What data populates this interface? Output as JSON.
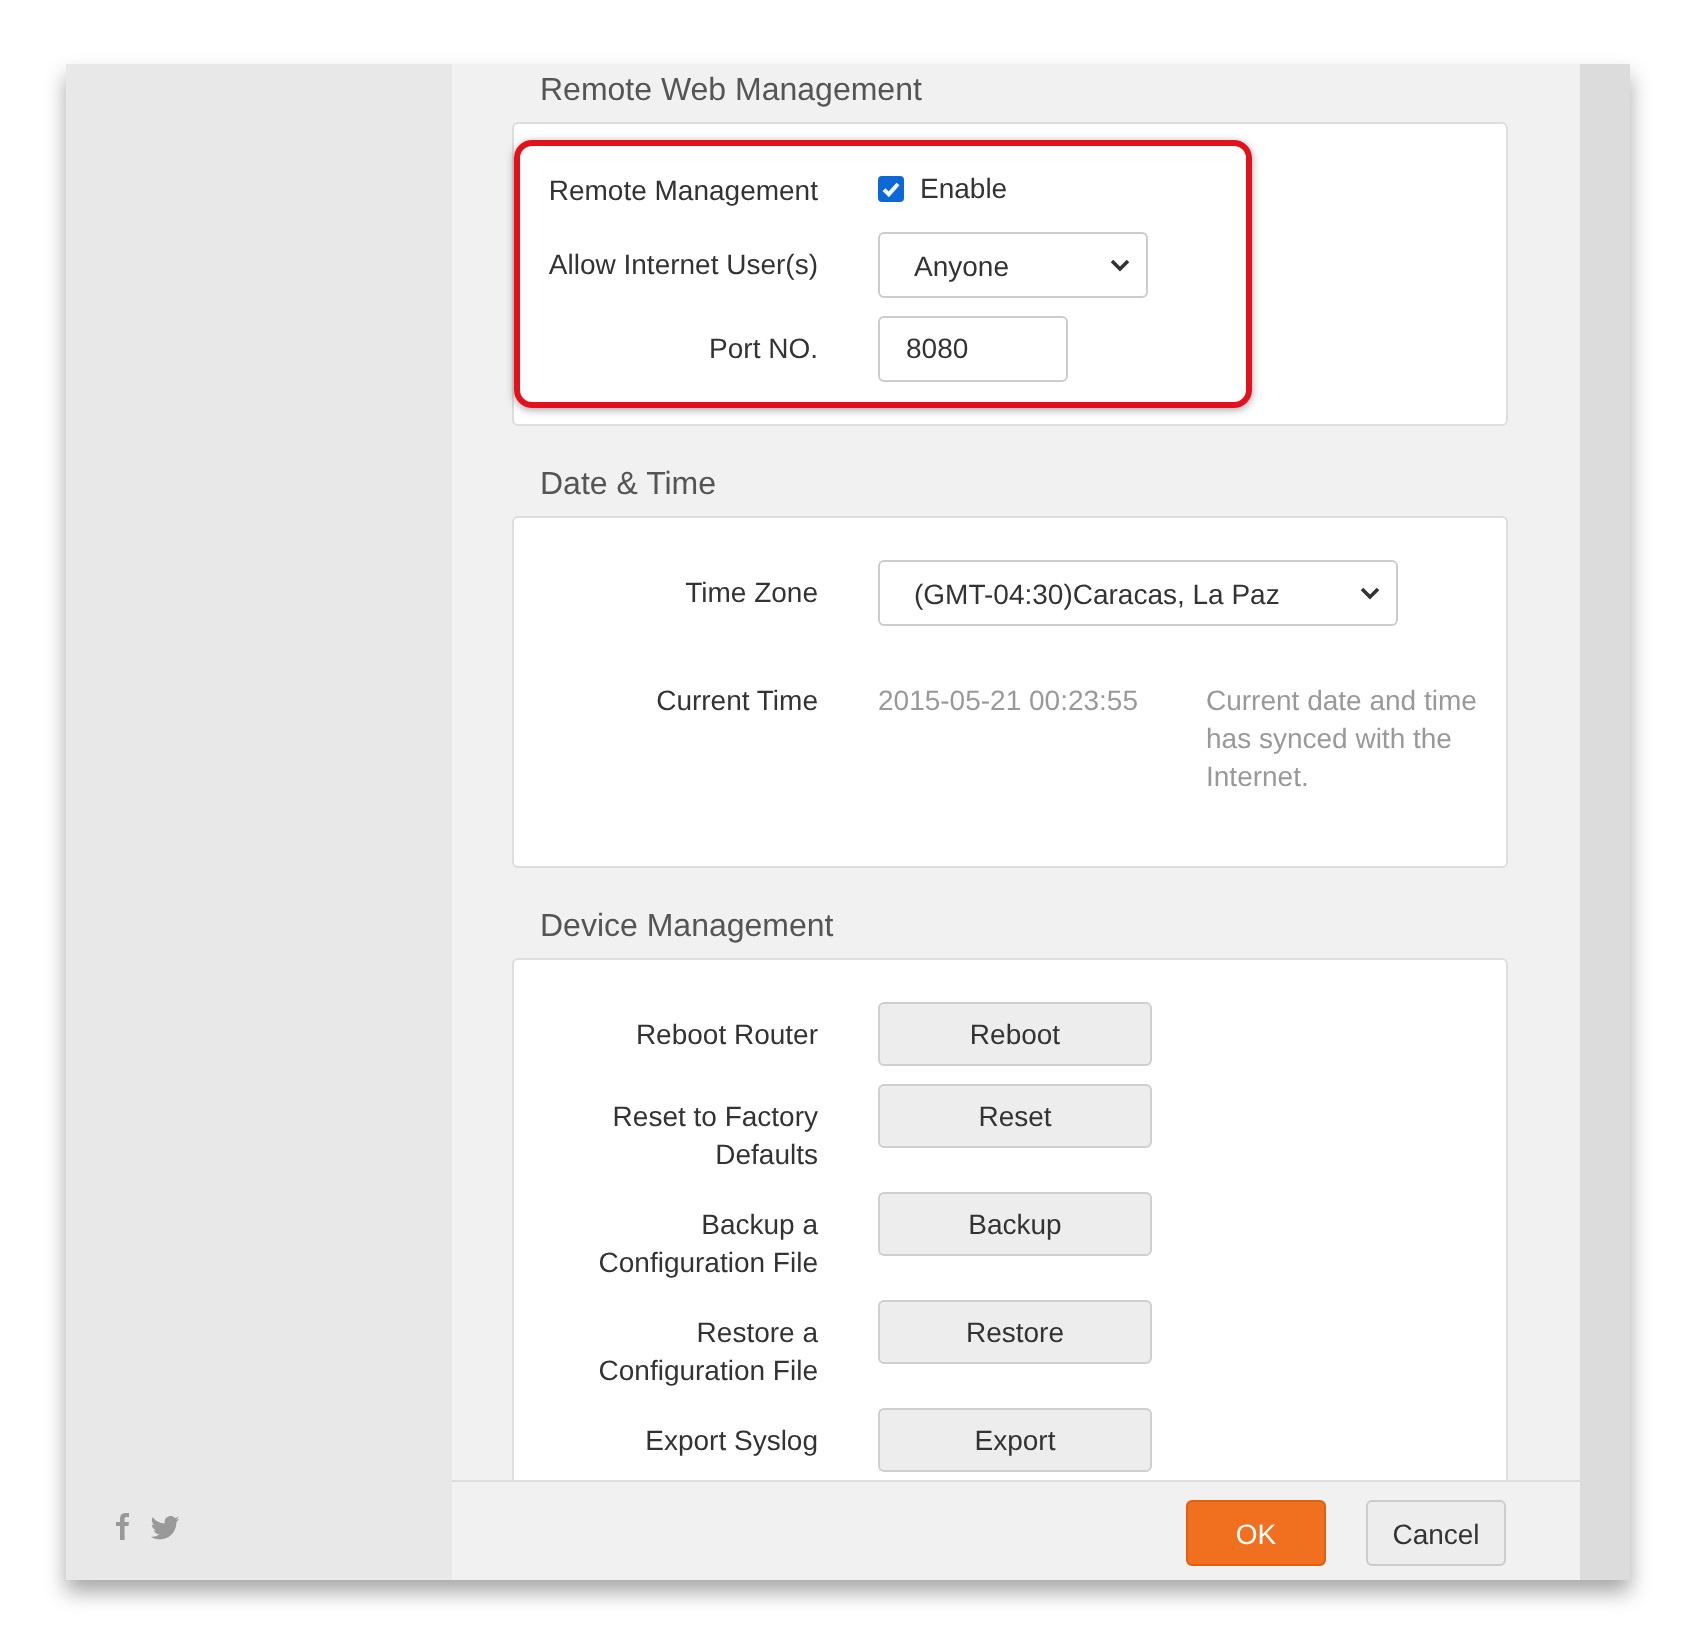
{
  "sections": [
    {
      "title": "Remote Web Management",
      "highlighted": true,
      "rows": [
        {
          "kind": "checkbox",
          "label": "Remote Management",
          "option": "Enable",
          "checked": true
        },
        {
          "kind": "select",
          "label": "Allow Internet User(s)",
          "value": "Anyone"
        },
        {
          "kind": "input",
          "label": "Port NO.",
          "value": "8080"
        }
      ]
    },
    {
      "title": "Date & Time",
      "highlighted": false,
      "rows": [
        {
          "kind": "select",
          "label": "Time Zone",
          "value": "(GMT-04:30)Caracas, La Paz"
        },
        {
          "kind": "info",
          "label": "Current Time",
          "value": "2015-05-21 00:23:55",
          "note": "Current date and time has synced with the Internet."
        }
      ]
    },
    {
      "title": "Device Management",
      "highlighted": false,
      "rows": [
        {
          "kind": "button",
          "label": "Reboot Router",
          "button": "Reboot"
        },
        {
          "kind": "button",
          "label": "Reset to Factory Defaults",
          "button": "Reset"
        },
        {
          "kind": "button",
          "label": "Backup a Configuration File",
          "button": "Backup"
        },
        {
          "kind": "button",
          "label": "Restore a Configuration File",
          "button": "Restore"
        },
        {
          "kind": "button",
          "label": "Export Syslog",
          "button": "Export"
        }
      ]
    }
  ],
  "footer": {
    "buttons": [
      {
        "label": "OK",
        "primary": true
      },
      {
        "label": "Cancel",
        "primary": false
      }
    ]
  }
}
